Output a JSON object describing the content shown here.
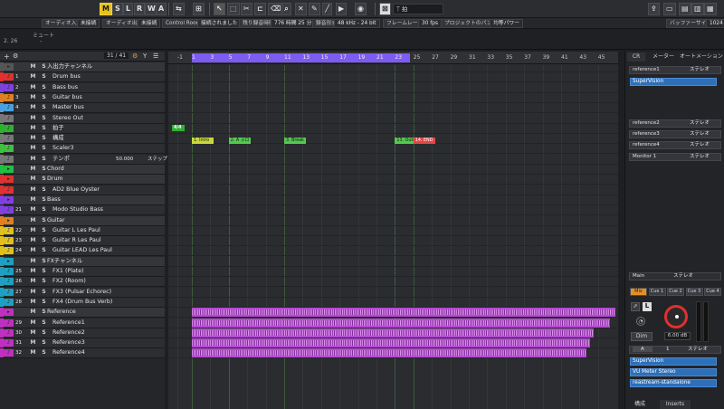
{
  "toolbar": {
    "mode_buttons": [
      "M",
      "S",
      "L",
      "R",
      "W",
      "A"
    ],
    "buffer_label": "バッファーサイズ",
    "buffer_value": "1024"
  },
  "status": {
    "audio_input": "オーディオ入力",
    "not_connected": "未接続",
    "audio_output": "オーディオ出力",
    "not_connected2": "未接続",
    "control_room": "Control Room",
    "connected": "接続されました",
    "remaining_label": "残り録音時間",
    "remaining_value": "776 時間 25 分",
    "rec_format_label": "録音形式",
    "rec_format_value": "48 kHz - 24 bit",
    "frame_rate_label": "フレームレート",
    "frame_rate_value": "30 fps",
    "pan_law": "プロジェクトのパン補正",
    "power": "均等パワー"
  },
  "info": {
    "position": "2. 26",
    "mute_label": "ミュート",
    "mute_value": "-"
  },
  "tracks_header": {
    "counter": "31 / 41"
  },
  "tracks": [
    {
      "name": "入出力チャンネル",
      "num": "",
      "type": "folder",
      "color": "#555"
    },
    {
      "name": "Drum bus",
      "num": "1",
      "color": "#e03030"
    },
    {
      "name": "Bass bus",
      "num": "2",
      "color": "#8040e0"
    },
    {
      "name": "Guitar bus",
      "num": "3",
      "color": "#e08020"
    },
    {
      "name": "Master bus",
      "num": "4",
      "color": "#4aa0e0"
    },
    {
      "name": "Stereo Out",
      "num": "",
      "color": "#777"
    },
    {
      "name": "拍子",
      "num": "",
      "color": "#30b030"
    },
    {
      "name": "構成",
      "num": "",
      "color": "#777"
    },
    {
      "name": "Scaler3",
      "num": "",
      "color": "#40c040"
    },
    {
      "name": "テンポ",
      "num": "",
      "color": "#777",
      "extra": "50.000",
      "extra2": "ステップ"
    },
    {
      "name": "Chord",
      "num": "",
      "type": "folder",
      "color": "#20c040"
    },
    {
      "name": "Drum",
      "num": "",
      "type": "folder",
      "color": "#e03030"
    },
    {
      "name": "AD2 Blue Oyster",
      "num": "",
      "color": "#e03030"
    },
    {
      "name": "Bass",
      "num": "",
      "type": "folder",
      "color": "#8040e0"
    },
    {
      "name": "Modo Studio Bass",
      "num": "21",
      "color": "#8040e0"
    },
    {
      "name": "Guitar",
      "num": "",
      "type": "folder",
      "color": "#e08020"
    },
    {
      "name": "Guitar L Les Paul",
      "num": "22",
      "color": "#e0c020"
    },
    {
      "name": "Guitar R Les Paul",
      "num": "23",
      "color": "#e0c020"
    },
    {
      "name": "Guitar LEAD Les Paul",
      "num": "24",
      "color": "#e0c020"
    },
    {
      "name": "FXチャンネル",
      "num": "",
      "type": "folder",
      "color": "#20a0c0"
    },
    {
      "name": "FX1 (Plate)",
      "num": "25",
      "color": "#20a0c0"
    },
    {
      "name": "FX2 (Room)",
      "num": "26",
      "color": "#20a0c0"
    },
    {
      "name": "FX3 (Pulsar Echorec)",
      "num": "27",
      "color": "#20a0c0"
    },
    {
      "name": "FX4 (Drum Bus Verb)",
      "num": "28",
      "color": "#20a0c0"
    },
    {
      "name": "Reference",
      "num": "",
      "type": "folder",
      "color": "#c030c0"
    },
    {
      "name": "Reference1",
      "num": "29",
      "color": "#c030c0"
    },
    {
      "name": "Reference2",
      "num": "30",
      "color": "#c030c0"
    },
    {
      "name": "Reference3",
      "num": "31",
      "color": "#c030c0"
    },
    {
      "name": "Reference4",
      "num": "32",
      "color": "#c030c0"
    }
  ],
  "ruler": {
    "bars": [
      "-1",
      "1",
      "3",
      "5",
      "7",
      "9",
      "11",
      "13",
      "15",
      "17",
      "19",
      "21",
      "23",
      "25",
      "27",
      "29",
      "31",
      "33",
      "35",
      "37",
      "39",
      "41",
      "43",
      "45"
    ]
  },
  "markers": [
    {
      "label": "1. Intro",
      "color": "#c8d83a",
      "bar": 1
    },
    {
      "label": "2. A メロ",
      "color": "#54c850",
      "bar": 5
    },
    {
      "label": "3. Break",
      "color": "#54c850",
      "bar": 11
    },
    {
      "label": "13. Outro",
      "color": "#54c850",
      "bar": 23
    },
    {
      "label": "14. END",
      "color": "#e04848",
      "bar": 25
    }
  ],
  "signature": "4/4",
  "right": {
    "tabs": [
      "CR",
      "メーター",
      "オートメーション"
    ],
    "references": [
      {
        "name": "reference1",
        "mode": "ステレオ"
      },
      {
        "name": "reference2",
        "mode": "ステレオ"
      },
      {
        "name": "reference3",
        "mode": "ステレオ"
      },
      {
        "name": "reference4",
        "mode": "ステレオ"
      },
      {
        "name": "Monitor 1",
        "mode": "ステレオ"
      }
    ],
    "ref1_slot": "SuperVision",
    "main_label": "Main",
    "main_mode": "ステレオ",
    "cues": [
      "Mix",
      "Cue 1",
      "Cue 2",
      "Cue 3",
      "Cue 4"
    ],
    "dim": "Dim",
    "gain": "6.00 dB",
    "input_a": "A",
    "input_num": "1",
    "input_mode": "ステレオ",
    "inserts": [
      "SuperVision",
      "VU Meter Stereo",
      "reastream-standalone"
    ],
    "bottom_tabs": [
      "構成",
      "Inserts"
    ]
  }
}
